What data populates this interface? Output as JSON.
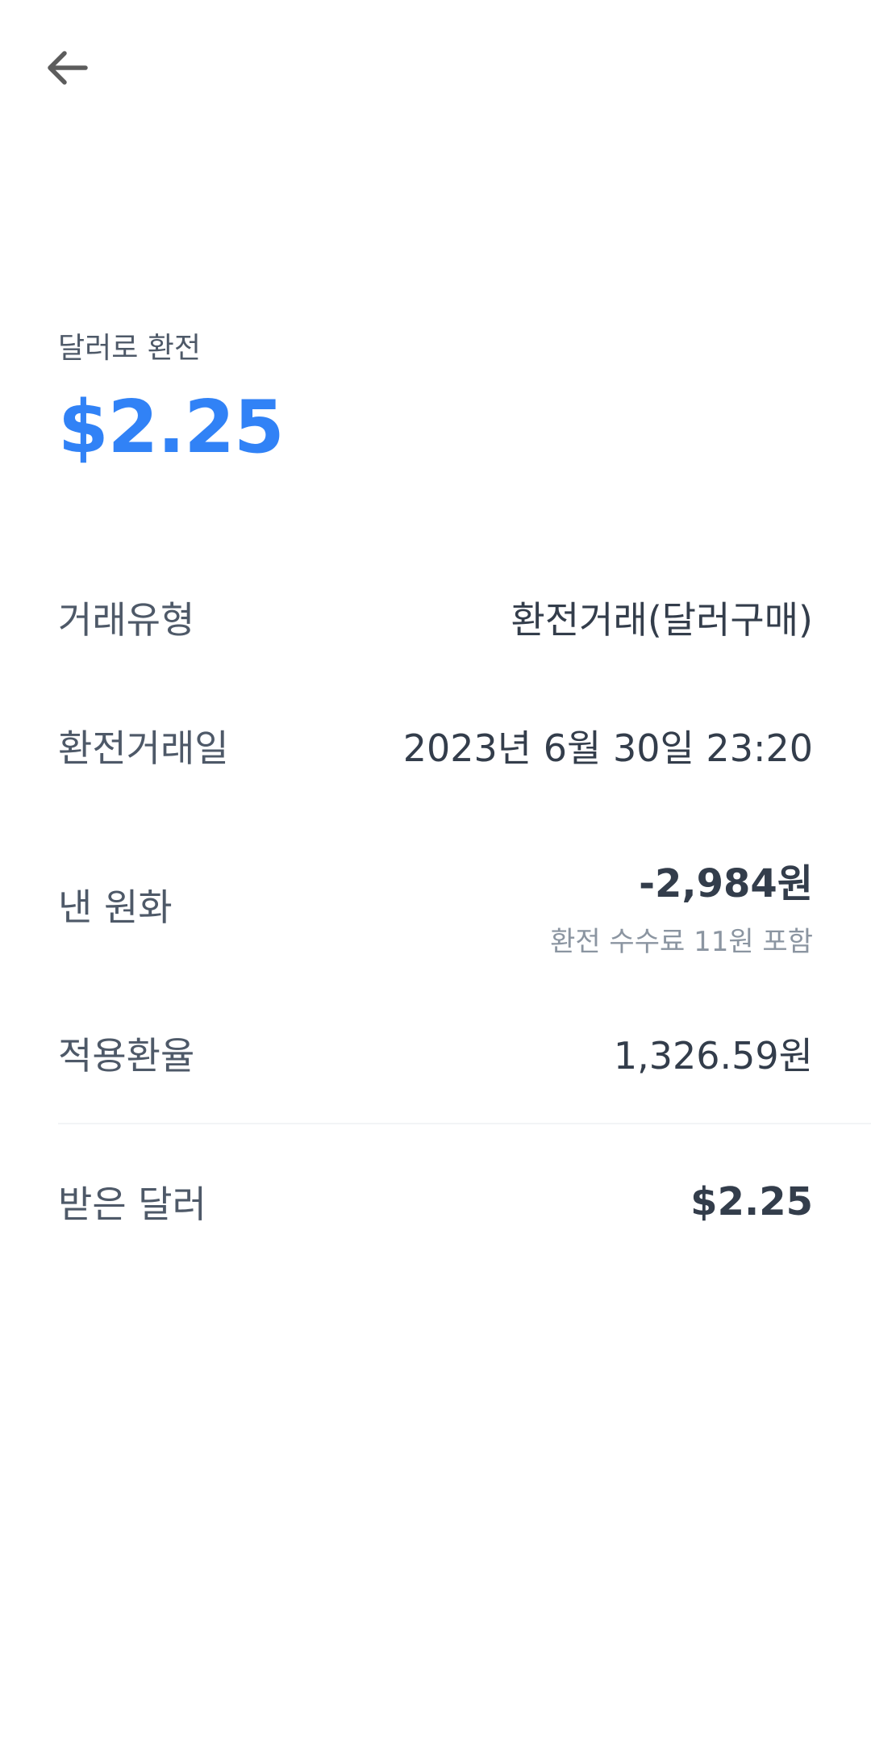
{
  "header": {
    "back_icon": "arrow-left-icon"
  },
  "summary": {
    "label": "달러로 환전",
    "amount": "$2.25",
    "amount_color": "#3182f6"
  },
  "details": {
    "type": {
      "label": "거래유형",
      "value": "환전거래(달러구매)"
    },
    "date": {
      "label": "환전거래일",
      "value": "2023년 6월 30일 23:20"
    },
    "paid": {
      "label": "낸 원화",
      "value": "-2,984원",
      "note": "환전 수수료 11원 포함"
    },
    "rate": {
      "label": "적용환율",
      "value": "1,326.59원"
    },
    "received": {
      "label": "받은 달러",
      "value": "$2.25"
    }
  }
}
